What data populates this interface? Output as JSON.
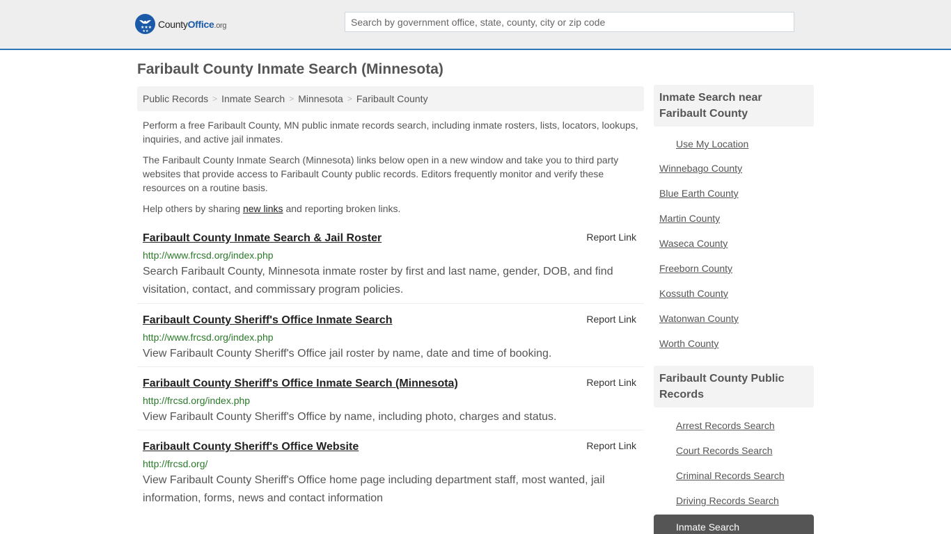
{
  "header": {
    "logo": {
      "county": "County",
      "office": "Office",
      "org": ".org"
    },
    "search": {
      "placeholder": "Search by government office, state, county, city or zip code",
      "value": ""
    }
  },
  "page_title": "Faribault County Inmate Search (Minnesota)",
  "breadcrumb": [
    "Public Records",
    "Inmate Search",
    "Minnesota",
    "Faribault County"
  ],
  "breadcrumb_sep": ">",
  "intro": {
    "p1": "Perform a free Faribault County, MN public inmate records search, including inmate rosters, lists, locators, lookups, inquiries, and active jail inmates.",
    "p2": "The Faribault County Inmate Search (Minnesota) links below open in a new window and take you to third party websites that provide access to Faribault County public records. Editors frequently monitor and verify these resources on a routine basis.",
    "p3_before": "Help others by sharing ",
    "p3_link": "new links",
    "p3_after": " and reporting broken links."
  },
  "results": [
    {
      "title": "Faribault County Inmate Search & Jail Roster",
      "url": "http://www.frcsd.org/index.php",
      "description": "Search Faribault County, Minnesota inmate roster by first and last name, gender, DOB, and find visitation, contact, and commissary program policies.",
      "report_label": "Report Link"
    },
    {
      "title": "Faribault County Sheriff's Office Inmate Search",
      "url": "http://www.frcsd.org/index.php",
      "description": "View Faribault County Sheriff's Office jail roster by name, date and time of booking.",
      "report_label": "Report Link"
    },
    {
      "title": "Faribault County Sheriff's Office Inmate Search (Minnesota)",
      "url": "http://frcsd.org/index.php",
      "description": "View Faribault County Sheriff's Office by name, including photo, charges and status.",
      "report_label": "Report Link"
    },
    {
      "title": "Faribault County Sheriff's Office Website",
      "url": "http://frcsd.org/",
      "description": "View Faribault County Sheriff's Office home page including department staff, most wanted, jail information, forms, news and contact information",
      "report_label": "Report Link"
    }
  ],
  "sidebar": {
    "nearby": {
      "heading": "Inmate Search near Faribault County",
      "use_location": "Use My Location",
      "counties": [
        "Winnebago County",
        "Blue Earth County",
        "Martin County",
        "Waseca County",
        "Freeborn County",
        "Kossuth County",
        "Watonwan County",
        "Worth County"
      ]
    },
    "public_records": {
      "heading": "Faribault County Public Records",
      "items": [
        "Arrest Records Search",
        "Court Records Search",
        "Criminal Records Search",
        "Driving Records Search",
        "Inmate Search"
      ],
      "active_index": 4
    }
  },
  "colors": {
    "accent_blue": "#2e75b6",
    "logo_blue": "#1b5aa8",
    "url_green": "#2a7a2a",
    "active_item_bg": "#555555"
  }
}
